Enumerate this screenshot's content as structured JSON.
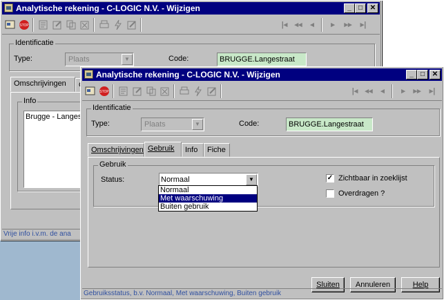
{
  "back_window": {
    "title": "Analytische rekening - C-LOGIC N.V. - Wijzigen",
    "identificatie_label": "Identificatie",
    "type_label": "Type:",
    "type_value": "Plaats",
    "code_label": "Code:",
    "code_value": "BRUGGE.Langestraat",
    "tabs": [
      "Omschrijvingen",
      "G"
    ],
    "info_label": "Info",
    "info_text": "Brugge - Langes",
    "status_text": "Vrije info i.v.m. de ana"
  },
  "front_window": {
    "title": "Analytische rekening - C-LOGIC N.V. - Wijzigen",
    "identificatie_label": "Identificatie",
    "type_label": "Type:",
    "type_value": "Plaats",
    "code_label": "Code:",
    "code_value": "BRUGGE.Langestraat",
    "tabs": [
      "Omschrijvingen",
      "Gebruik",
      "Info",
      "Fiche"
    ],
    "gebruik_label": "Gebruik",
    "status_label": "Status:",
    "status_value": "Normaal",
    "status_options": [
      "Normaal",
      "Met waarschuwing",
      "Buiten gebruik"
    ],
    "selected_option_index": 1,
    "zichtbaar_label": "Zichtbaar in zoeklijst",
    "zichtbaar_checked": true,
    "overdragen_label": "Overdragen ?",
    "overdragen_checked": false,
    "buttons": {
      "sluiten": "Sluiten",
      "annuleren": "Annuleren",
      "help": "Help"
    },
    "status_text": "Gebruiksstatus, b.v. Normaal, Met waarschuwing, Buiten gebruik"
  },
  "colors": {
    "titlebar": "#000080",
    "window_face": "#c0c0c0",
    "code_bg": "#c8e8c8",
    "status_text": "#3050a0"
  }
}
